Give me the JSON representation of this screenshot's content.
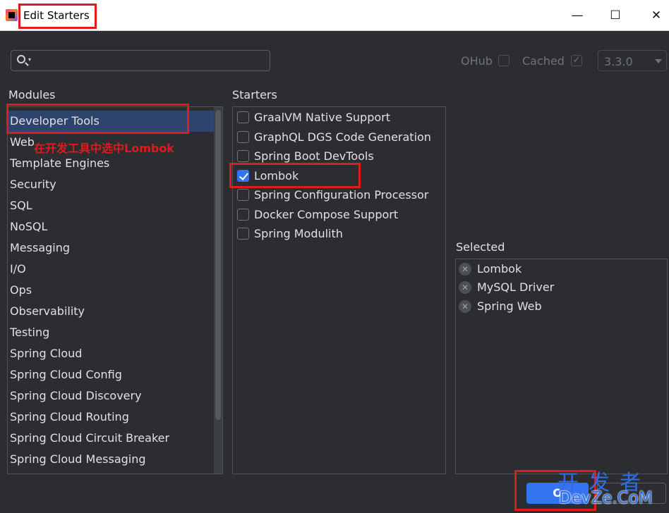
{
  "window": {
    "title": "Edit Starters",
    "controls": {
      "minimize": "—",
      "maximize": "☐",
      "close": "✕"
    }
  },
  "toolbar": {
    "search_placeholder": "",
    "ohub_label": "OHub",
    "ohub_checked": false,
    "cached_label": "Cached",
    "cached_checked": true,
    "cached_mark": "✓",
    "version": "3.3.0"
  },
  "modules": {
    "heading": "Modules",
    "items": [
      "Developer Tools",
      "Web",
      "Template Engines",
      "Security",
      "SQL",
      "NoSQL",
      "Messaging",
      "I/O",
      "Ops",
      "Observability",
      "Testing",
      "Spring Cloud",
      "Spring Cloud Config",
      "Spring Cloud Discovery",
      "Spring Cloud Routing",
      "Spring Cloud Circuit Breaker",
      "Spring Cloud Messaging"
    ],
    "selected": "Developer Tools"
  },
  "annotation": {
    "note": "在开发工具中选中Lombok",
    "color": "#e01b1b"
  },
  "starters": {
    "heading": "Starters",
    "items": [
      {
        "label": "GraalVM Native Support",
        "checked": false
      },
      {
        "label": "GraphQL DGS Code Generation",
        "checked": false
      },
      {
        "label": "Spring Boot DevTools",
        "checked": false
      },
      {
        "label": "Lombok",
        "checked": true
      },
      {
        "label": "Spring Configuration Processor",
        "checked": false
      },
      {
        "label": "Docker Compose Support",
        "checked": false
      },
      {
        "label": "Spring Modulith",
        "checked": false
      }
    ]
  },
  "selected": {
    "heading": "Selected",
    "remove_glyph": "✕",
    "items": [
      "Lombok",
      "MySQL Driver",
      "Spring Web"
    ]
  },
  "footer": {
    "ok_label": "O"
  },
  "watermark": {
    "top": "开发者",
    "bottom": "DevZe.CoM"
  },
  "colors": {
    "background": "#2b2d30",
    "accent": "#3574f0",
    "selection": "#2e436e",
    "annotation": "#e01b1b"
  }
}
